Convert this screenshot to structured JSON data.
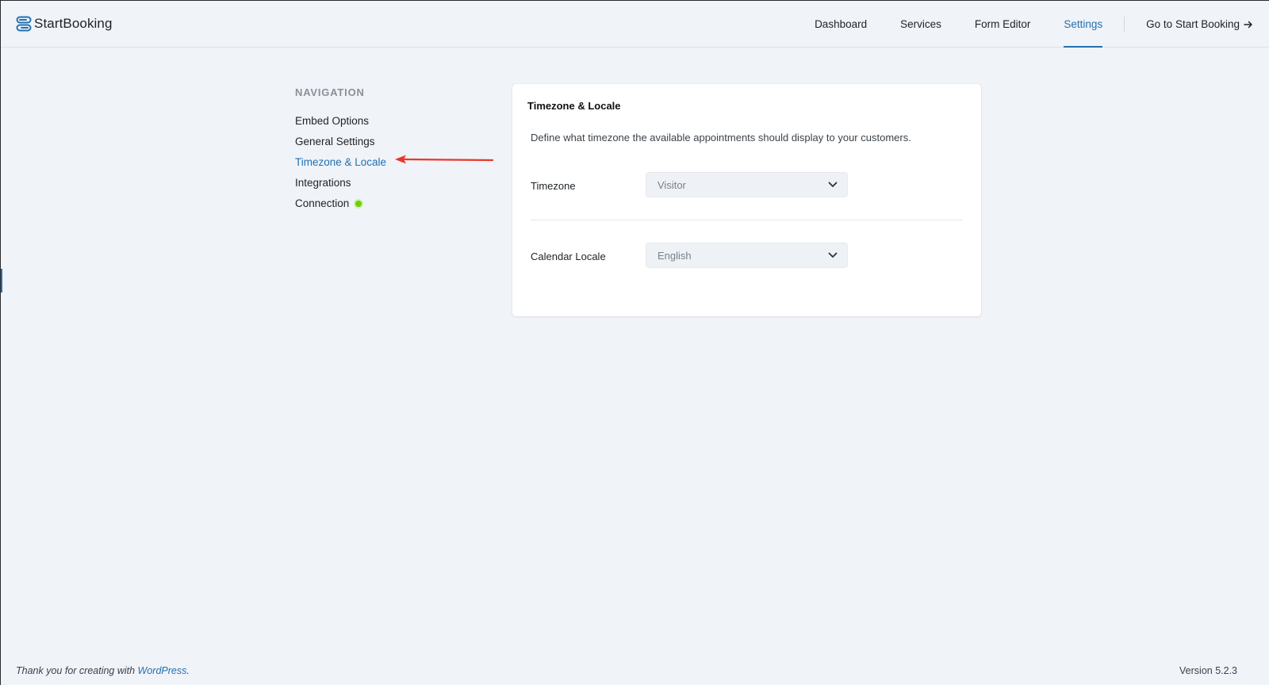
{
  "brand": {
    "name": "StartBooking",
    "accent_color": "#2271b1"
  },
  "header": {
    "nav": [
      {
        "label": "Dashboard",
        "active": false
      },
      {
        "label": "Services",
        "active": false
      },
      {
        "label": "Form Editor",
        "active": false
      },
      {
        "label": "Settings",
        "active": true
      }
    ],
    "external_link": {
      "label": "Go to Start Booking",
      "icon": "arrow-right-icon"
    }
  },
  "sidebar": {
    "heading": "NAVIGATION",
    "items": [
      {
        "label": "Embed Options",
        "active": false
      },
      {
        "label": "General Settings",
        "active": false
      },
      {
        "label": "Timezone & Locale",
        "active": true
      },
      {
        "label": "Integrations",
        "active": false
      },
      {
        "label": "Connection",
        "active": false,
        "status": "connected",
        "status_color": "#6cd000"
      }
    ]
  },
  "annotation": {
    "icon": "red-arrow-icon",
    "color": "#e8382b"
  },
  "card": {
    "title": "Timezone & Locale",
    "description": "Define what timezone the available appointments should display to your customers.",
    "timezone": {
      "label": "Timezone",
      "value": "Visitor"
    },
    "calendar_locale": {
      "label": "Calendar Locale",
      "value": "English"
    }
  },
  "footer": {
    "thanks_prefix": "Thank you for creating with ",
    "thanks_link": "WordPress",
    "thanks_suffix": ".",
    "version": "Version 5.2.3"
  }
}
